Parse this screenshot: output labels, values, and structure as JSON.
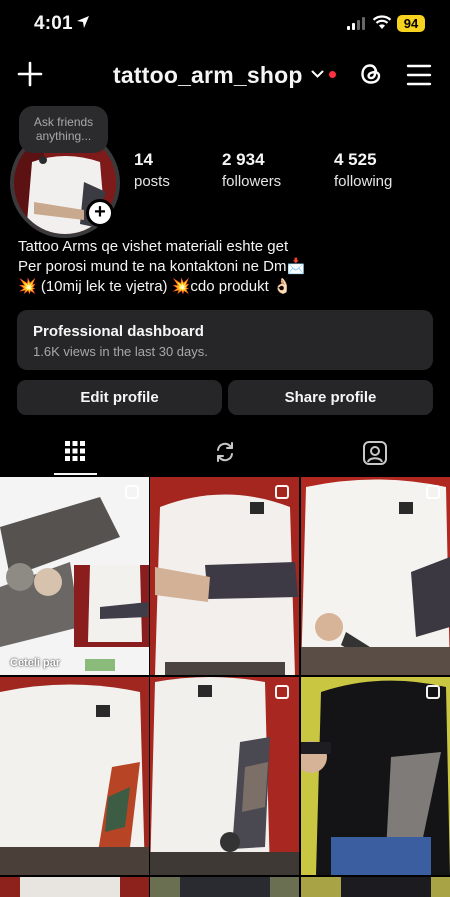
{
  "status_bar": {
    "time": "4:01",
    "battery": "94"
  },
  "header": {
    "username": "tattoo_arm_shop"
  },
  "note": {
    "text": "Ask friends anything..."
  },
  "stats": [
    {
      "value": "14",
      "label": "posts"
    },
    {
      "value": "2 934",
      "label": "followers"
    },
    {
      "value": "4 525",
      "label": "following"
    }
  ],
  "bio": {
    "line1": "Tattoo Arms qe vishet materiali eshte get",
    "line2": "Per porosi mund te na kontaktoni ne Dm📩",
    "line3": "💥 (10mij lek te vjetra) 💥cdo produkt 👌🏻"
  },
  "dashboard": {
    "title": "Professional dashboard",
    "subtitle": "1.6K views in the last 30 days."
  },
  "buttons": {
    "edit": "Edit profile",
    "share": "Share profile"
  },
  "tabs": [
    {
      "icon": "grid-icon",
      "active": true
    },
    {
      "icon": "reels-repost-icon",
      "active": false
    },
    {
      "icon": "tagged-icon",
      "active": false
    }
  ],
  "grid": {
    "first_caption": "Ceteli par"
  },
  "colors": {
    "background": "#000000",
    "card": "#262628",
    "notification_dot": "#ff3040",
    "battery": "#f7d21e"
  }
}
